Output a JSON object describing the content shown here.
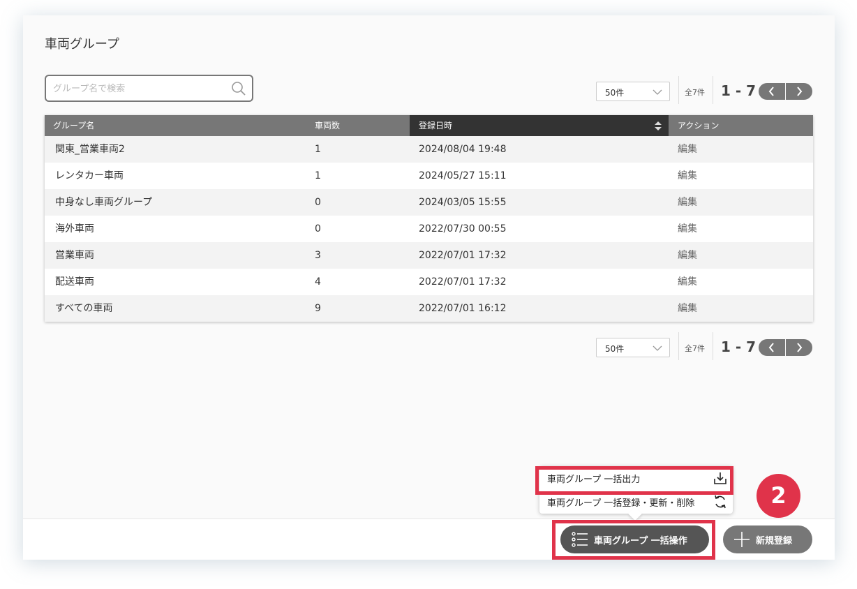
{
  "page": {
    "title": "車両グループ"
  },
  "search": {
    "placeholder": "グループ名で検索"
  },
  "pager": {
    "per_page": "50件",
    "total": "全7件",
    "range": "1 - 7"
  },
  "table": {
    "headers": [
      "グループ名",
      "車両数",
      "登録日時",
      "アクション"
    ],
    "sorted_column": "登録日時",
    "rows": [
      {
        "name": "関東_営業車両2",
        "count": "1",
        "date": "2024/08/04 19:48",
        "action": "編集"
      },
      {
        "name": "レンタカー車両",
        "count": "1",
        "date": "2024/05/27 15:11",
        "action": "編集"
      },
      {
        "name": "中身なし車両グループ",
        "count": "0",
        "date": "2024/03/05 15:55",
        "action": "編集"
      },
      {
        "name": "海外車両",
        "count": "0",
        "date": "2022/07/30 00:55",
        "action": "編集"
      },
      {
        "name": "営業車両",
        "count": "3",
        "date": "2022/07/01 17:32",
        "action": "編集"
      },
      {
        "name": "配送車両",
        "count": "4",
        "date": "2022/07/01 17:32",
        "action": "編集"
      },
      {
        "name": "すべての車両",
        "count": "9",
        "date": "2022/07/01 16:12",
        "action": "編集"
      }
    ]
  },
  "popup_menu": {
    "items": [
      {
        "label": "車両グループ 一括出力",
        "icon": "download-icon"
      },
      {
        "label": "車両グループ 一括登録・更新・削除",
        "icon": "refresh-icon"
      }
    ]
  },
  "annotation": {
    "step": "2",
    "color": "#e0334a"
  },
  "footer": {
    "bulk_label": "車両グループ 一括操作",
    "new_label": "新規登録"
  }
}
